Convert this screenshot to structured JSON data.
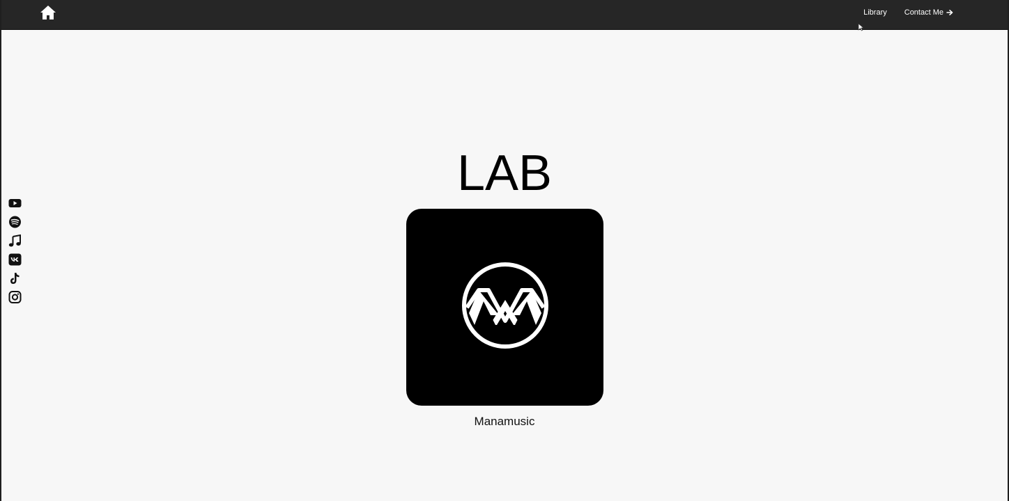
{
  "nav": {
    "home_icon": "home-icon",
    "links": [
      {
        "label": "Library"
      },
      {
        "label": "Contact Me",
        "icon": "arrow-right-icon"
      }
    ]
  },
  "social": [
    {
      "icon": "youtube-icon"
    },
    {
      "icon": "spotify-icon"
    },
    {
      "icon": "music-note-icon"
    },
    {
      "icon": "vk-icon"
    },
    {
      "icon": "tiktok-icon"
    },
    {
      "icon": "instagram-icon"
    }
  ],
  "main": {
    "title": "LAB",
    "item": {
      "caption": "Manamusic",
      "logo": "manamusic-logo"
    }
  },
  "colors": {
    "topbar": "#262626",
    "background": "#f7f7f7",
    "card": "#000000"
  }
}
